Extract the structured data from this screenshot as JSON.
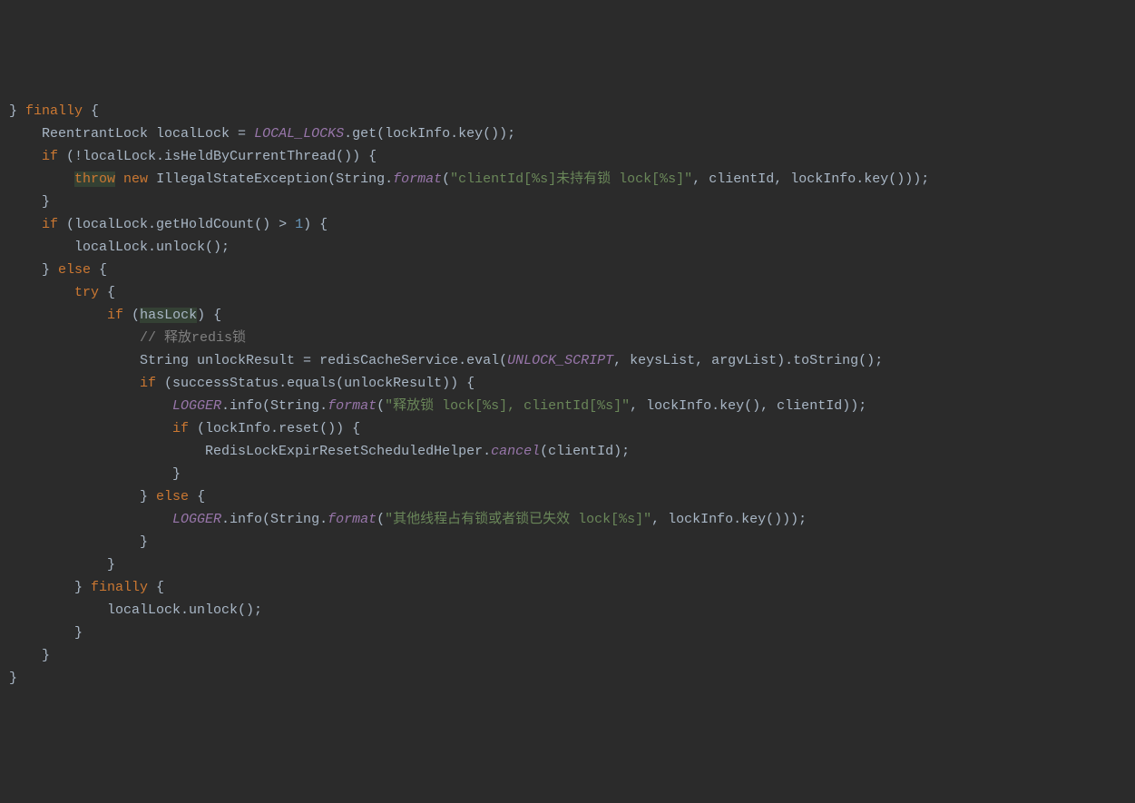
{
  "code": {
    "lines": [
      {
        "indent": 0,
        "tokens": [
          {
            "t": "brace",
            "v": "} "
          },
          {
            "t": "kw",
            "v": "finally"
          },
          {
            "t": "punct",
            "v": " {"
          }
        ]
      },
      {
        "indent": 1,
        "tokens": [
          {
            "t": "type",
            "v": "ReentrantLock localLock = "
          },
          {
            "t": "static",
            "v": "LOCAL_LOCKS"
          },
          {
            "t": "punct",
            "v": ".get(lockInfo.key());"
          }
        ]
      },
      {
        "indent": 1,
        "tokens": [
          {
            "t": "kw",
            "v": "if"
          },
          {
            "t": "punct",
            "v": " (!localLock.isHeldByCurrentThread()) {"
          }
        ]
      },
      {
        "indent": 2,
        "tokens": [
          {
            "t": "kw-hl",
            "v": "throw"
          },
          {
            "t": "punct",
            "v": " "
          },
          {
            "t": "kw",
            "v": "new"
          },
          {
            "t": "punct",
            "v": " IllegalStateException(String."
          },
          {
            "t": "static-call",
            "v": "format"
          },
          {
            "t": "punct",
            "v": "("
          },
          {
            "t": "str",
            "v": "\"clientId[%s]未持有锁 lock[%s]\""
          },
          {
            "t": "punct",
            "v": ", clientId, lockInfo.key()));"
          }
        ]
      },
      {
        "indent": 1,
        "tokens": [
          {
            "t": "brace",
            "v": "}"
          }
        ]
      },
      {
        "indent": 1,
        "tokens": [
          {
            "t": "kw",
            "v": "if"
          },
          {
            "t": "punct",
            "v": " (localLock.getHoldCount() > "
          },
          {
            "t": "num",
            "v": "1"
          },
          {
            "t": "punct",
            "v": ") {"
          }
        ]
      },
      {
        "indent": 2,
        "tokens": [
          {
            "t": "punct",
            "v": "localLock.unlock();"
          }
        ]
      },
      {
        "indent": 1,
        "tokens": [
          {
            "t": "brace",
            "v": "} "
          },
          {
            "t": "kw",
            "v": "else"
          },
          {
            "t": "punct",
            "v": " {"
          }
        ]
      },
      {
        "indent": 2,
        "tokens": [
          {
            "t": "kw",
            "v": "try"
          },
          {
            "t": "punct",
            "v": " {"
          }
        ]
      },
      {
        "indent": 3,
        "tokens": [
          {
            "t": "kw",
            "v": "if"
          },
          {
            "t": "punct",
            "v": " ("
          },
          {
            "t": "sel-var",
            "v": "hasLock"
          },
          {
            "t": "punct",
            "v": ") {"
          }
        ]
      },
      {
        "indent": 4,
        "tokens": [
          {
            "t": "comment",
            "v": "// 释放redis锁"
          }
        ]
      },
      {
        "indent": 4,
        "tokens": [
          {
            "t": "punct",
            "v": "String unlockResult = redisCacheService.eval("
          },
          {
            "t": "static",
            "v": "UNLOCK_SCRIPT"
          },
          {
            "t": "punct",
            "v": ", keysList, argvList).toString();"
          }
        ]
      },
      {
        "indent": 4,
        "tokens": [
          {
            "t": "kw",
            "v": "if"
          },
          {
            "t": "punct",
            "v": " (successStatus.equals(unlockResult)) {"
          }
        ]
      },
      {
        "indent": 5,
        "tokens": [
          {
            "t": "static",
            "v": "LOGGER"
          },
          {
            "t": "punct",
            "v": ".info(String."
          },
          {
            "t": "static-call",
            "v": "format"
          },
          {
            "t": "punct",
            "v": "("
          },
          {
            "t": "str",
            "v": "\"释放锁 lock[%s], clientId[%s]\""
          },
          {
            "t": "punct",
            "v": ", lockInfo.key(), clientId));"
          }
        ]
      },
      {
        "indent": 5,
        "tokens": [
          {
            "t": "kw",
            "v": "if"
          },
          {
            "t": "punct",
            "v": " (lockInfo.reset()) {"
          }
        ]
      },
      {
        "indent": 6,
        "tokens": [
          {
            "t": "punct",
            "v": "RedisLockExpirResetScheduledHelper."
          },
          {
            "t": "static-call",
            "v": "cancel"
          },
          {
            "t": "punct",
            "v": "(clientId);"
          }
        ]
      },
      {
        "indent": 5,
        "tokens": [
          {
            "t": "brace",
            "v": "}"
          }
        ]
      },
      {
        "indent": 4,
        "tokens": [
          {
            "t": "brace",
            "v": "} "
          },
          {
            "t": "kw",
            "v": "else"
          },
          {
            "t": "punct",
            "v": " {"
          }
        ]
      },
      {
        "indent": 5,
        "tokens": [
          {
            "t": "static",
            "v": "LOGGER"
          },
          {
            "t": "punct",
            "v": ".info(String."
          },
          {
            "t": "static-call",
            "v": "format"
          },
          {
            "t": "punct",
            "v": "("
          },
          {
            "t": "str",
            "v": "\"其他线程占有锁或者锁已失效 lock[%s]\""
          },
          {
            "t": "punct",
            "v": ", lockInfo.key()));"
          }
        ]
      },
      {
        "indent": 4,
        "tokens": [
          {
            "t": "brace",
            "v": "}"
          }
        ]
      },
      {
        "indent": 3,
        "tokens": [
          {
            "t": "brace",
            "v": "}"
          }
        ]
      },
      {
        "indent": 2,
        "tokens": [
          {
            "t": "brace",
            "v": "} "
          },
          {
            "t": "kw",
            "v": "finally"
          },
          {
            "t": "punct",
            "v": " {"
          }
        ]
      },
      {
        "indent": 3,
        "tokens": [
          {
            "t": "punct",
            "v": "localLock.unlock();"
          }
        ]
      },
      {
        "indent": 2,
        "tokens": [
          {
            "t": "brace",
            "v": "}"
          }
        ]
      },
      {
        "indent": 1,
        "tokens": [
          {
            "t": "brace",
            "v": "}"
          }
        ]
      },
      {
        "indent": 0,
        "tokens": [
          {
            "t": "brace",
            "v": "}"
          }
        ]
      }
    ],
    "indent_unit": "    "
  }
}
